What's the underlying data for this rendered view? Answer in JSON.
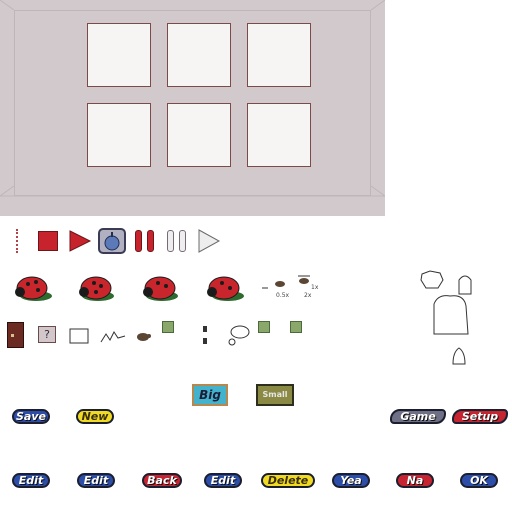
{
  "tags": {
    "big": "Big",
    "small": "Small"
  },
  "buttons": {
    "save": "Save",
    "new": "New",
    "game": "Game",
    "setup": "Setup",
    "edit_1": "Edit",
    "edit_2": "Edit",
    "back": "Back",
    "edit_3": "Edit",
    "delete": "Delete",
    "yea": "Yea",
    "na": "Na",
    "ok": "OK"
  },
  "speed_labels": {
    "half": "0.5x",
    "one": "1x",
    "two": "2x"
  },
  "icons": {
    "controls": [
      "divider-icon",
      "stop-icon",
      "play-icon",
      "bug-view-icon",
      "pause-icon",
      "pause-grey-icon",
      "play-grey-icon"
    ],
    "ladybugs": [
      "ladybug-icon",
      "ladybug-icon",
      "ladybug-icon",
      "ladybug-icon"
    ],
    "tools": [
      "door-icon",
      "help-icon",
      "frame-icon",
      "squiggle-icon",
      "turtle-icon",
      "magnify-icon",
      "eraser-icon",
      "speech-bubble-icon",
      "key-icon",
      "arrow-icon"
    ],
    "creatures": [
      "bird-icon",
      "ghost-icon",
      "critter-icon",
      "bell-icon"
    ]
  },
  "colors": {
    "panel_bg": "#d1c9cb",
    "slot_bg": "#f7f5f4",
    "accent_red": "#c7232d",
    "button_blue": "#2c4ea8",
    "button_yellow": "#f1da23",
    "button_red": "#c62431",
    "button_grey": "#6f6f86"
  }
}
